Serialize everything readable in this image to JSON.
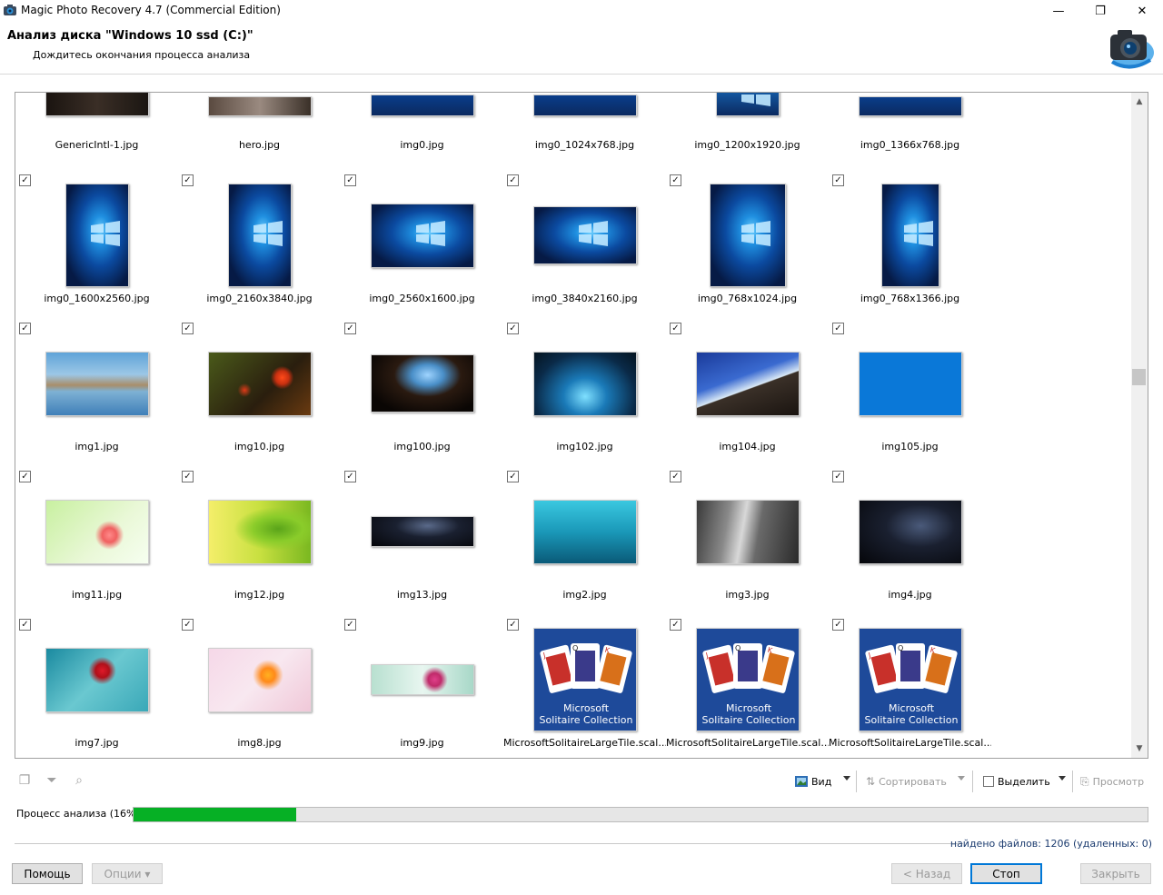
{
  "window": {
    "title": "Magic Photo Recovery 4.7 (Commercial Edition)",
    "minimize": "—",
    "restore": "❐",
    "close": "✕"
  },
  "header": {
    "title": "Анализ диска \"Windows 10 ssd (C:)\"",
    "subtitle": "Дождитесь окончания процесса анализа"
  },
  "files": [
    {
      "name": "GenericIntl-1.jpg",
      "checked": true,
      "kind": "dark-partial"
    },
    {
      "name": "hero.jpg",
      "checked": true,
      "kind": "hero-partial"
    },
    {
      "name": "img0.jpg",
      "checked": true,
      "kind": "win-partial"
    },
    {
      "name": "img0_1024x768.jpg",
      "checked": true,
      "kind": "win-partial"
    },
    {
      "name": "img0_1200x1920.jpg",
      "checked": true,
      "kind": "win-tall-partial"
    },
    {
      "name": "img0_1366x768.jpg",
      "checked": true,
      "kind": "win-partial-thin"
    },
    {
      "name": "img0_1600x2560.jpg",
      "checked": true,
      "kind": "win-tall"
    },
    {
      "name": "img0_2160x3840.jpg",
      "checked": true,
      "kind": "win-tall"
    },
    {
      "name": "img0_2560x1600.jpg",
      "checked": true,
      "kind": "win-wide"
    },
    {
      "name": "img0_3840x2160.jpg",
      "checked": true,
      "kind": "win-wider"
    },
    {
      "name": "img0_768x1024.jpg",
      "checked": true,
      "kind": "win-tall2"
    },
    {
      "name": "img0_768x1366.jpg",
      "checked": true,
      "kind": "win-tall3"
    },
    {
      "name": "img1.jpg",
      "checked": true,
      "kind": "beach"
    },
    {
      "name": "img10.jpg",
      "checked": true,
      "kind": "tulip"
    },
    {
      "name": "img100.jpg",
      "checked": true,
      "kind": "cave"
    },
    {
      "name": "img102.jpg",
      "checked": true,
      "kind": "ice"
    },
    {
      "name": "img104.jpg",
      "checked": true,
      "kind": "mountain"
    },
    {
      "name": "img105.jpg",
      "checked": true,
      "kind": "blue"
    },
    {
      "name": "img11.jpg",
      "checked": true,
      "kind": "pinkflower"
    },
    {
      "name": "img12.jpg",
      "checked": true,
      "kind": "leaf"
    },
    {
      "name": "img13.jpg",
      "checked": true,
      "kind": "night-thin"
    },
    {
      "name": "img2.jpg",
      "checked": true,
      "kind": "underwater"
    },
    {
      "name": "img3.jpg",
      "checked": true,
      "kind": "rock"
    },
    {
      "name": "img4.jpg",
      "checked": true,
      "kind": "night"
    },
    {
      "name": "img7.jpg",
      "checked": true,
      "kind": "redflower"
    },
    {
      "name": "img8.jpg",
      "checked": true,
      "kind": "orangeflower"
    },
    {
      "name": "img9.jpg",
      "checked": true,
      "kind": "lotus"
    },
    {
      "name": "MicrosoftSolitaireLargeTile.scal...",
      "checked": true,
      "kind": "solitaire"
    },
    {
      "name": "MicrosoftSolitaireLargeTile.scal...",
      "checked": true,
      "kind": "solitaire"
    },
    {
      "name": "MicrosoftSolitaireLargeTile.scal...",
      "checked": true,
      "kind": "solitaire"
    }
  ],
  "solitaire_text": {
    "line1": "Microsoft",
    "line2": "Solitaire Collection"
  },
  "toolbar": {
    "view_label": "Вид",
    "sort_label": "Сортировать",
    "select_label": "Выделить",
    "preview_label": "Просмотр"
  },
  "progress": {
    "label": "Процесс анализа (16%)",
    "fraction": 0.16
  },
  "status": {
    "found": "найдено файлов: 1206 (удаленных: 0)"
  },
  "buttons": {
    "help": "Помощь",
    "options": "Опции ▾",
    "back": "< Назад",
    "stop": "Стоп",
    "close": "Закрыть"
  },
  "colors": {
    "progress": "#06b025",
    "default_button_border": "#0078d7"
  }
}
